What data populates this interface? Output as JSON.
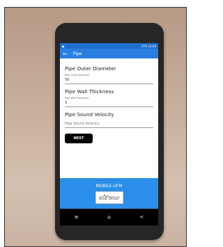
{
  "status_bar": {
    "time": "14:04",
    "battery": "37%"
  },
  "app_bar": {
    "title": "Pipe",
    "back_icon": "arrow-left-icon"
  },
  "form": {
    "outer_diameter": {
      "title": "Pipe Outer Diameter",
      "label": "Pipe Outer Diameter",
      "value": "50"
    },
    "wall_thickness": {
      "title": "Pipe Wall Thickness",
      "label": "Pipe Wall Thickness",
      "value": "3"
    },
    "sound_velocity": {
      "title": "Pipe Sound Velocity",
      "placeholder": "Pipe Sound Velocity:"
    },
    "next_label": "NEXT"
  },
  "footer": {
    "title": "MOBILE-UFM",
    "logo_text": "Sonic Driver"
  },
  "nav": {
    "menu_icon": "≡",
    "home_icon": "⌂",
    "back_icon": "<"
  },
  "colors": {
    "accent": "#2b7fe0",
    "status": "#1f6fd0",
    "footer": "#2b8ee8"
  }
}
